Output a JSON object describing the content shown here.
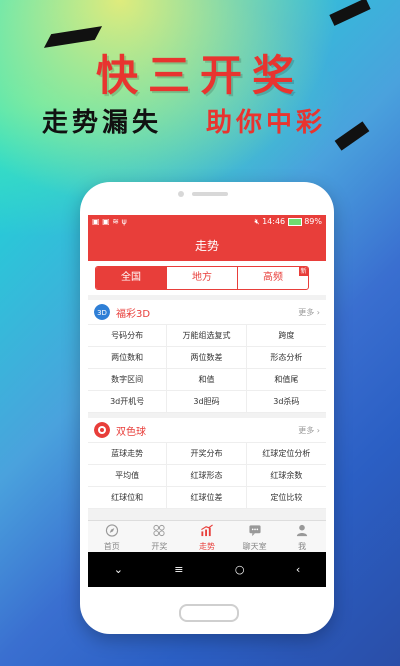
{
  "banner": {
    "title": "快三开奖",
    "tagline_left": "走势漏失",
    "tagline_right": "助你中彩"
  },
  "status_bar": {
    "time": "14:46",
    "battery": "89%"
  },
  "header": {
    "title": "走势"
  },
  "tabs": [
    {
      "label": "全国",
      "active": true
    },
    {
      "label": "地方",
      "active": false
    },
    {
      "label": "高频",
      "active": false,
      "badge": "新"
    }
  ],
  "sections": [
    {
      "icon": "fucai-3d-logo-icon",
      "title": "福彩3D",
      "more": "更多",
      "items": [
        "号码分布",
        "万能组选复式",
        "跨度",
        "两位数和",
        "两位数差",
        "形态分析",
        "数字区间",
        "和值",
        "和值尾",
        "3d开机号",
        "3d胆码",
        "3d杀码"
      ]
    },
    {
      "icon": "double-color-ball-logo-icon",
      "title": "双色球",
      "more": "更多",
      "items": [
        "蓝球走势",
        "开奖分布",
        "红球定位分析",
        "平均值",
        "红球形态",
        "红球余数",
        "红球位和",
        "红球位差",
        "定位比较"
      ]
    }
  ],
  "bottom_nav": [
    {
      "label": "首页",
      "icon": "compass-icon",
      "active": false
    },
    {
      "label": "开奖",
      "icon": "grid-icon",
      "active": false
    },
    {
      "label": "走势",
      "icon": "trend-chart-icon",
      "active": true
    },
    {
      "label": "聊天室",
      "icon": "chat-bubble-icon",
      "active": false
    },
    {
      "label": "我",
      "icon": "user-icon",
      "active": false
    }
  ],
  "system_nav": {
    "down": "⌄",
    "menu": "≡",
    "home": "○",
    "back": "‹"
  },
  "colors": {
    "brand_red": "#e83e3a",
    "banner_red": "#e8342f"
  }
}
